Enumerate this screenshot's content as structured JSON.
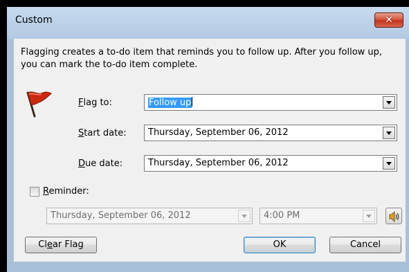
{
  "window": {
    "title": "Custom",
    "close_label": "✕"
  },
  "description": "Flagging creates a to-do item that reminds you to follow up. After you follow up, you can mark the to-do item complete.",
  "fields": {
    "flag_to": {
      "label_u": "F",
      "label_rest": "lag to:",
      "value": "Follow up"
    },
    "start_date": {
      "label_u": "S",
      "label_rest": "tart date:",
      "value": "Thursday, September 06, 2012"
    },
    "due_date": {
      "label_u": "D",
      "label_rest": "ue date:",
      "value": "Thursday, September 06, 2012"
    }
  },
  "reminder": {
    "label_u": "R",
    "label_rest": "eminder:",
    "checked": false,
    "date": "Thursday, September 06, 2012",
    "time": "4:00 PM"
  },
  "buttons": {
    "clear_pre": "Cl",
    "clear_u": "e",
    "clear_post": "ar Flag",
    "ok": "OK",
    "cancel": "Cancel"
  },
  "colors": {
    "flag": "#cc2a10",
    "selection": "#3399ff",
    "close": "#c0331b"
  },
  "icons": {
    "flag": "red-flag-icon",
    "sound": "speaker-icon",
    "close": "close-icon"
  }
}
